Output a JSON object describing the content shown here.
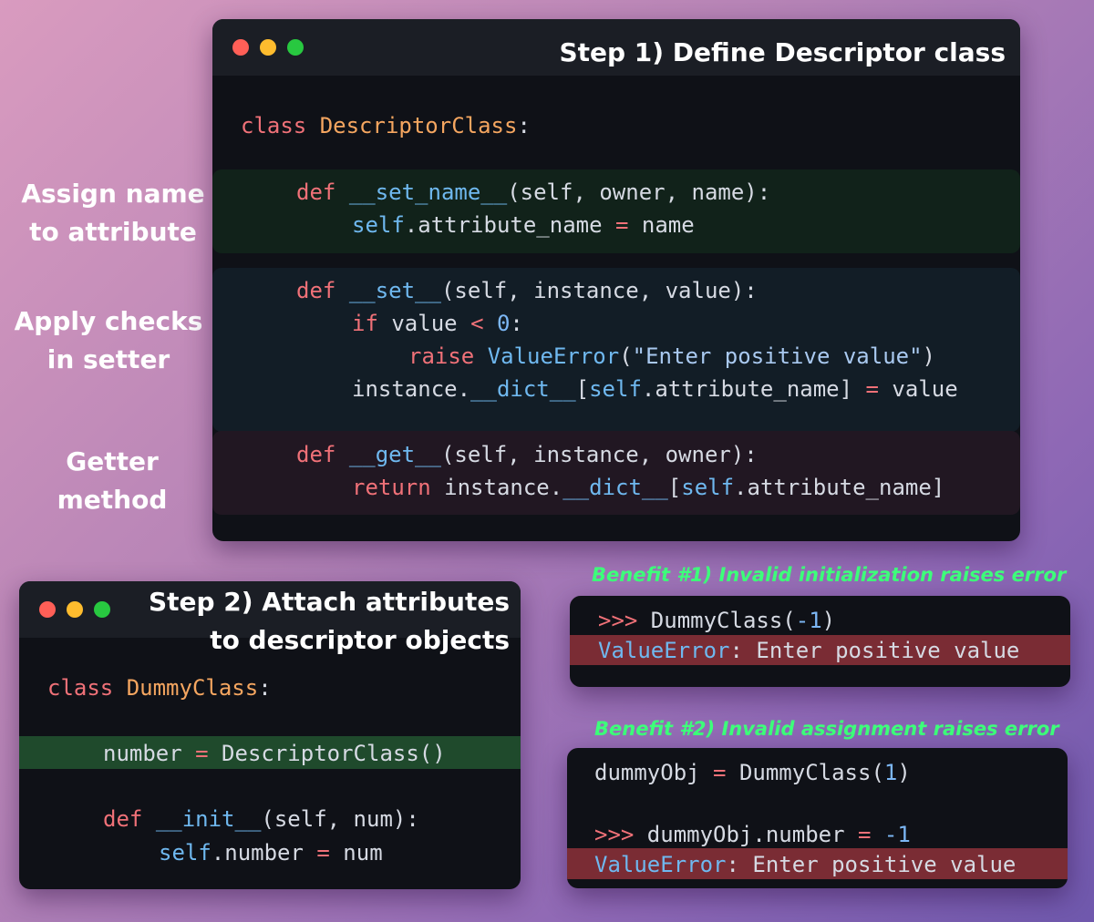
{
  "labels": {
    "set_name": "Assign name\nto attribute",
    "setter": "Apply checks\nin setter",
    "getter": "Getter\nmethod"
  },
  "window1": {
    "title": "Step 1) Define Descriptor class",
    "code": {
      "class_kw": "class",
      "class_name": "DescriptorClass",
      "colon": ":",
      "def": "def",
      "set_name": "__set_name__",
      "set_name_args": "(self, owner, name):",
      "self": "self",
      "attr_assign": ".attribute_name ",
      "eq": "=",
      "name_val": " name",
      "set": "__set__",
      "set_args": "(self, instance, value):",
      "if": "if",
      "value_word": " value ",
      "lt": "<",
      "zero": "0",
      "raise": "raise",
      "value_error": "ValueError",
      "paren_open": "(",
      "msg": "\"Enter positive value\"",
      "paren_close": ")",
      "instance_dot": "instance.",
      "dict": "__dict__",
      "bracket_open": "[",
      "attr_name_close": ".attribute_name] ",
      "value_end": " value",
      "get": "__get__",
      "get_args": "(self, instance, owner):",
      "return": "return",
      "return_mid": " instance.",
      "attr_name_end": ".attribute_name]"
    }
  },
  "window2": {
    "title": "Step 2) Attach attributes\nto descriptor objects",
    "code": {
      "class_kw": "class",
      "class_name": "DummyClass",
      "colon": ":",
      "number_attr": "number ",
      "eq": "=",
      "descriptor_call": " DescriptorClass()",
      "def": "def",
      "init": "__init__",
      "init_args": "(self, num):",
      "self": "self",
      "number_assign": ".number ",
      "num_val": " num"
    }
  },
  "benefit1": {
    "heading": "Benefit #1) Invalid initialization raises error",
    "prompt": ">>>",
    "call": " DummyClass(",
    "neg_one": "-1",
    "call_close": ")",
    "error_name": "ValueError",
    "error_msg": ": Enter positive value"
  },
  "benefit2": {
    "heading": "Benefit #2) Invalid assignment raises error",
    "line1_var": "dummyObj ",
    "eq": "=",
    "line1_call": " DummyClass(",
    "one": "1",
    "line1_close": ")",
    "prompt": ">>>",
    "line2_attr": " dummyObj.number ",
    "neg_one": "-1",
    "error_name": "ValueError",
    "error_msg": ": Enter positive value"
  },
  "colors": {
    "keyword": "#f07178",
    "class_name": "#f5a660",
    "function": "#6fb8ef",
    "benefit_heading": "#3dff7a",
    "error_bar": "#7a2c34"
  }
}
